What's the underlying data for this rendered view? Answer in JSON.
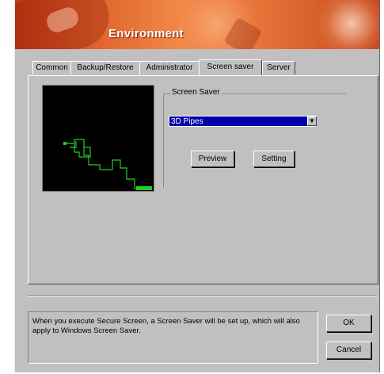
{
  "window": {
    "title": "Environment"
  },
  "tabs": [
    {
      "label": "Common",
      "active": false
    },
    {
      "label": "Backup/Restore",
      "active": false
    },
    {
      "label": "Administrator",
      "active": false
    },
    {
      "label": "Screen saver",
      "active": true
    },
    {
      "label": "Server",
      "active": false
    }
  ],
  "screen_saver": {
    "group_label": "Screen Saver",
    "selected": "3D Pipes",
    "preview_button": "Preview",
    "setting_button": "Setting"
  },
  "info_text": "When you execute Secure Screen, a Screen Saver  will be set up, which will also apply to Windows Screen Saver.",
  "buttons": {
    "ok": "OK",
    "cancel": "Cancel"
  },
  "colors": {
    "banner": "#e0642c",
    "dialog": "#c0c0c0",
    "selection": "#0000a8",
    "pipes": "#22cc22"
  },
  "icons": {
    "dropdown": "chevron-down-icon"
  }
}
